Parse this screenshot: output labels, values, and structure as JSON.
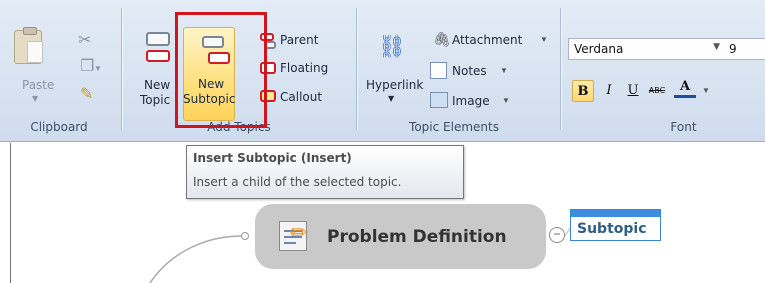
{
  "ribbon": {
    "clipboard": {
      "group_label": "Clipboard",
      "paste_label": "Paste"
    },
    "add_topics": {
      "group_label": "Add Topics",
      "new_topic_label": "New\nTopic",
      "new_topic_line1": "New",
      "new_topic_line2": "Topic",
      "new_subtopic_line1": "New",
      "new_subtopic_line2": "Subtopic",
      "parent_label": "Parent",
      "floating_label": "Floating",
      "callout_label": "Callout"
    },
    "topic_elements": {
      "group_label": "Topic Elements",
      "hyperlink_label": "Hyperlink",
      "attachment_label": "Attachment",
      "notes_label": "Notes",
      "image_label": "Image"
    },
    "font": {
      "group_label": "Font",
      "font_name": "Verdana",
      "font_size": "9",
      "bold": "B",
      "italic": "I",
      "underline": "U",
      "strikethrough": "ABC",
      "font_color": "A"
    }
  },
  "tooltip": {
    "title": "Insert Subtopic (Insert)",
    "description": "Insert a child of the selected topic."
  },
  "canvas": {
    "central_topic": "Problem Definition",
    "subtopic": "Subtopic",
    "collapse_symbol": "−"
  },
  "colors": {
    "highlight": "#d2141c",
    "hover": "#ffd96e",
    "subtopic_accent": "#3b8ee0"
  }
}
